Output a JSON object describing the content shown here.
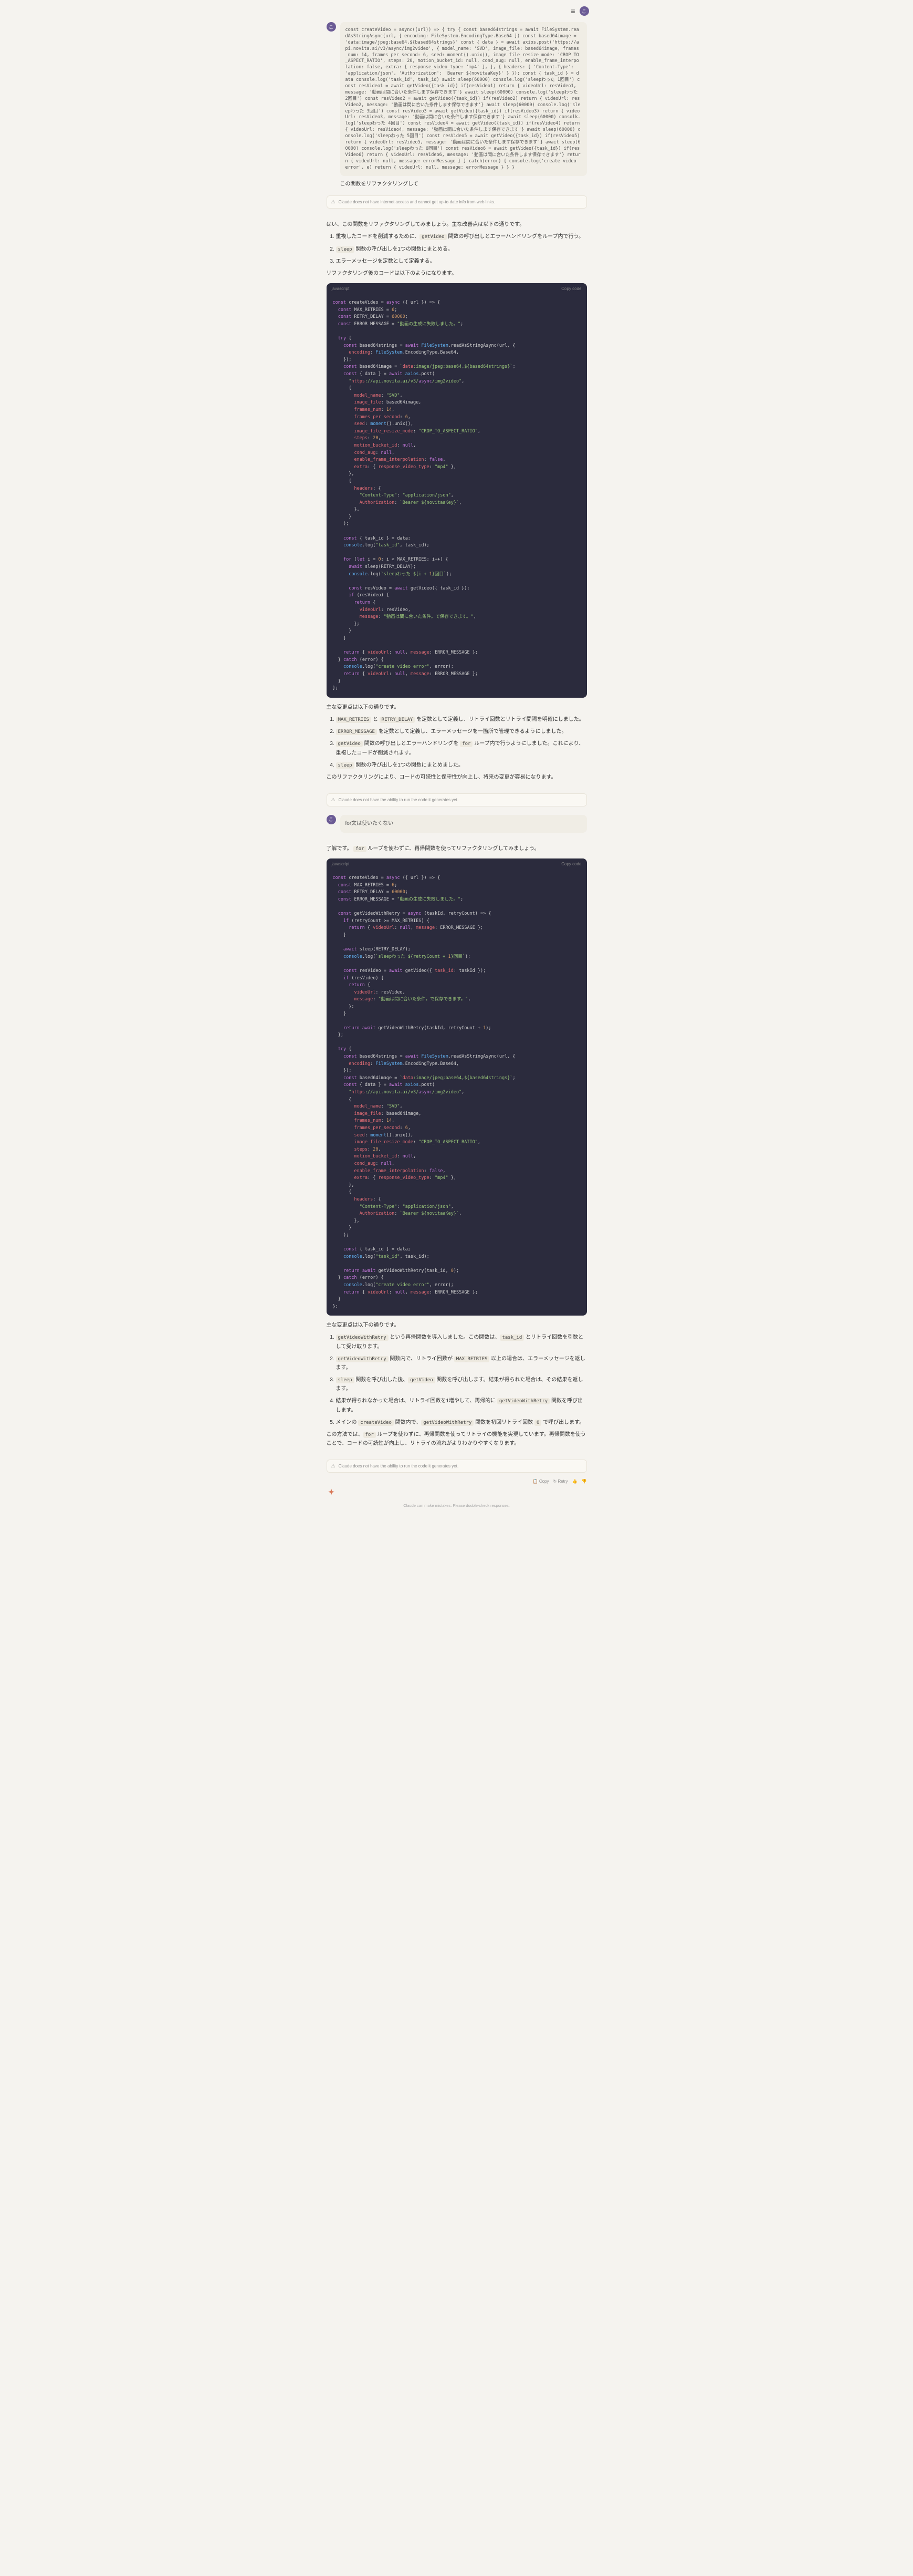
{
  "header": {
    "avatar": "こ"
  },
  "user_msg1": {
    "code": "const createVideo = async((url)) => { try { const based64strings = await FileSystem.readAsStringAsync(url, { encoding: FileSystem.EncodingType.Base64 }) const based64image = 'data:image/jpeg;base64,${based64strings}' const { data } = await axios.post('https://api.novita.ai/v3/async/img2video', { model_name: 'SVD', image_file: based64image, frames_num: 14, frames_per_second: 6, seed: moment().unix(), image_file_resize_mode: 'CROP_TO_ASPECT_RATIO', steps: 20, motion_bucket_id: null, cond_aug: null, enable_frame_interpolation: false, extra: { response_video_type: 'mp4' }, }, { headers: { 'Content-Type': 'application/json', 'Authorization': 'Bearer ${novitaaKey}' } }); const { task_id } = data console.log('task_id', task_id) await sleep(60000) console.log('sleepわった 1回目') const resVideo1 = await getVideo({task_id}) if(resVideo1) return { videoUrl: resVideo1, message: '動画は間に合いた条件します保存できます'} await sleep(60000) console.log('sleepわった 2回目') const resVideo2 = await getVideo({task_id}) if(resVideo2) return { videoUrl: resVideo2, message: '動画は間に合いた条件します保存できます'} await sleep(60000) console.log('sleepわった 3回目') const resVideo3 = await getVideo({task_id}) if(resVideo3) return { videoUrl: resVideo3, message: '動画は間に合いた条件します保存できます'} await sleep(60000) consolk.log('sleepわった 4回目') const resVideo4 = await getVideo({task_id}) if(resVideo4) return { videoUrl: resVideo4, message: '動画は間に合いた条件します保存できます'} await sleep(60000) console.log('sleepわった 5回目') const resVideo5 = await getVideo({task_id}) if(resVideo5) return { videoUrl: resVideo5, message: '動画は間に合いた条件します保存できます'} await sleep(60000) console.log('sleepわった 6回目') const resVideo6 = await getVideo({task_id}) if(resVideo6) return { videoUrl: resVideo6, message: '動画は間に合いた条件します保存できます'} return { videoUrl: null, message: errorMessage } } catch(error) { console.log('create video error', e) return { videoUrl: null, message: errorMessage } } }",
    "text": "この関数をリファクタリングして"
  },
  "warning1": "Claude does not have internet access and cannot get up-to-date info from web links.",
  "assistant1": {
    "intro": "はい、この関数をリファクタリングしてみましょう。主な改善点は以下の通りです。",
    "points": [
      "重複したコードを削減するために、{getVideo} 関数の呼び出しとエラーハンドリングをループ内で行う。",
      "{sleep} 関数の呼び出しを1つの関数にまとめる。",
      "エラーメッセージを定数として定義する。"
    ],
    "outro": "リファクタリング後のコードは以下のようになります。",
    "code_lang": "javascript",
    "copy": "Copy code"
  },
  "code1": "const createVideo = async ({ url }) => {\n  const MAX_RETRIES = 6;\n  const RETRY_DELAY = 60000;\n  const ERROR_MESSAGE = \"動画の生成に失敗しました。\";\n\n  try {\n    const based64strings = await FileSystem.readAsStringAsync(url, {\n      encoding: FileSystem.EncodingType.Base64,\n    });\n    const based64image = `data:image/jpeg;base64,${based64strings}`;\n    const { data } = await axios.post(\n      \"https://api.novita.ai/v3/async/img2video\",\n      {\n        model_name: \"SVD\",\n        image_file: based64image,\n        frames_num: 14,\n        frames_per_second: 6,\n        seed: moment().unix(),\n        image_file_resize_mode: \"CROP_TO_ASPECT_RATIO\",\n        steps: 20,\n        motion_bucket_id: null,\n        cond_aug: null,\n        enable_frame_interpolation: false,\n        extra: { response_video_type: \"mp4\" },\n      },\n      {\n        headers: {\n          \"Content-Type\": \"application/json\",\n          Authorization: `Bearer ${novitaaKey}`,\n        },\n      }\n    );\n\n    const { task_id } = data;\n    console.log(\"task_id\", task_id);\n\n    for (let i = 0; i < MAX_RETRIES; i++) {\n      await sleep(RETRY_DELAY);\n      console.log(`sleepわった ${i + 1}回目`);\n\n      const resVideo = await getVideo({ task_id });\n      if (resVideo) {\n        return {\n          videoUrl: resVideo,\n          message: \"動画は間に合いた条件。で保存できます。\",\n        };\n      }\n    }\n\n    return { videoUrl: null, message: ERROR_MESSAGE };\n  } catch (error) {\n    console.log(\"create video error\", error);\n    return { videoUrl: null, message: ERROR_MESSAGE };\n  }\n};",
  "assistant1b": {
    "intro": "主な変更点は以下の通りです。",
    "points": [
      "{MAX_RETRIES} と {RETRY_DELAY} を定数として定義し、リトライ回数とリトライ間隔を明確にしました。",
      "{ERROR_MESSAGE} を定数として定義し、エラーメッセージを一箇所で管理できるようにしました。",
      "{getVideo} 関数の呼び出しとエラーハンドリングを {for} ループ内で行うようにしました。これにより、重複したコードが削減されます。",
      "{sleep} 関数の呼び出しを1つの関数にまとめました。"
    ],
    "outro": "このリファクタリングにより、コードの可読性と保守性が向上し、将来の変更が容易になります。"
  },
  "warning2": "Claude does not have the ability to run the code it generates yet.",
  "user_msg2": {
    "text": "for文は使いたくない"
  },
  "assistant2": {
    "intro": "了解です。 {for} ループを使わずに、再帰関数を使ってリファクタリングしてみましょう。"
  },
  "code2": "const createVideo = async ({ url }) => {\n  const MAX_RETRIES = 6;\n  const RETRY_DELAY = 60000;\n  const ERROR_MESSAGE = \"動画の生成に失敗しました。\";\n\n  const getVideoWithRetry = async (taskId, retryCount) => {\n    if (retryCount >= MAX_RETRIES) {\n      return { videoUrl: null, message: ERROR_MESSAGE };\n    }\n\n    await sleep(RETRY_DELAY);\n    console.log(`sleepわった ${retryCount + 1}回目`);\n\n    const resVideo = await getVideo({ task_id: taskId });\n    if (resVideo) {\n      return {\n        videoUrl: resVideo,\n        message: \"動画は間に合いた条件。で保存できます。\",\n      };\n    }\n\n    return await getVideoWithRetry(taskId, retryCount + 1);\n  };\n\n  try {\n    const based64strings = await FileSystem.readAsStringAsync(url, {\n      encoding: FileSystem.EncodingType.Base64,\n    });\n    const based64image = `data:image/jpeg;base64,${based64strings}`;\n    const { data } = await axios.post(\n      \"https://api.novita.ai/v3/async/img2video\",\n      {\n        model_name: \"SVD\",\n        image_file: based64image,\n        frames_num: 14,\n        frames_per_second: 6,\n        seed: moment().unix(),\n        image_file_resize_mode: \"CROP_TO_ASPECT_RATIO\",\n        steps: 20,\n        motion_bucket_id: null,\n        cond_aug: null,\n        enable_frame_interpolation: false,\n        extra: { response_video_type: \"mp4\" },\n      },\n      {\n        headers: {\n          \"Content-Type\": \"application/json\",\n          Authorization: `Bearer ${novitaaKey}`,\n        },\n      }\n    );\n\n    const { task_id } = data;\n    console.log(\"task_id\", task_id);\n\n    return await getVideoWithRetry(task_id, 0);\n  } catch (error) {\n    console.log(\"create video error\", error);\n    return { videoUrl: null, message: ERROR_MESSAGE };\n  }\n};",
  "assistant2b": {
    "intro": "主な変更点は以下の通りです。",
    "points": [
      "{getVideoWithRetry} という再帰関数を導入しました。この関数は、{task_id} とリトライ回数を引数として受け取ります。",
      "{getVideoWithRetry} 関数内で、リトライ回数が {MAX_RETRIES} 以上の場合は、エラーメッセージを返します。",
      "{sleep} 関数を呼び出した後、{getVideo} 関数を呼び出します。結果が得られた場合は、その結果を返します。",
      "結果が得られなかった場合は、リトライ回数を1増やして、再帰的に {getVideoWithRetry} 関数を呼び出します。",
      "メインの {createVideo} 関数内で、{getVideoWithRetry} 関数を初回リトライ回数 {0} で呼び出します。"
    ],
    "outro": "この方法では、{for} ループを使わずに、再帰関数を使ってリトライの機能を実現しています。再帰関数を使うことで、コードの可読性が向上し、リトライの流れがよりわかりやすくなります。"
  },
  "footer": {
    "copy": "Copy",
    "retry": "Retry",
    "note": "Claude can make mistakes. Please double-check responses."
  }
}
